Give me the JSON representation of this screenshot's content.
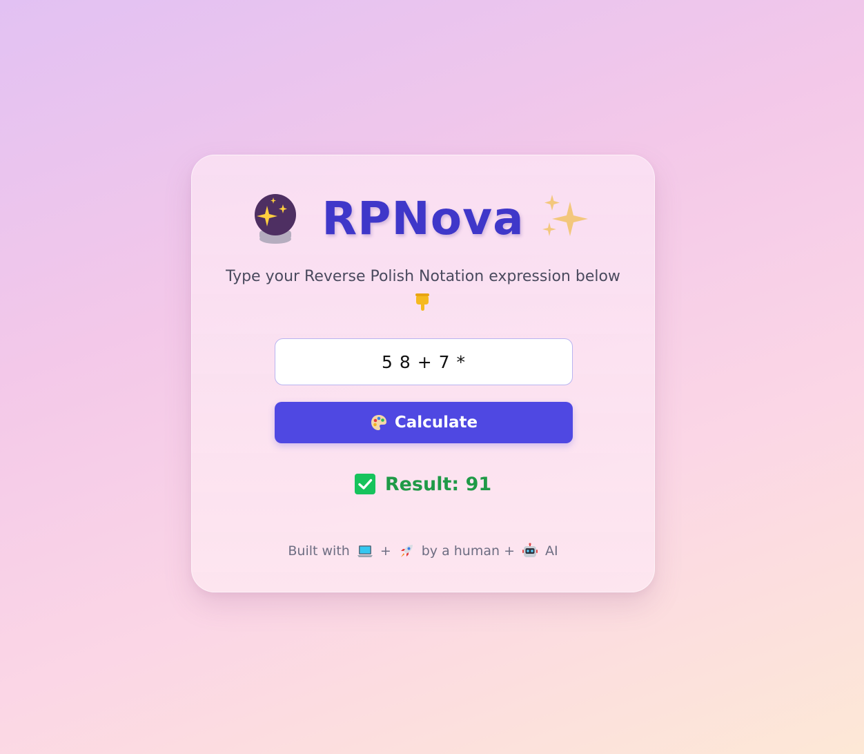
{
  "app": {
    "title": "RPNova"
  },
  "subtitle": {
    "text": "Type your Reverse Polish Notation expression below"
  },
  "input": {
    "value": "5 8 + 7 *",
    "placeholder": ""
  },
  "button": {
    "label": "Calculate"
  },
  "result": {
    "text": "Result: 91"
  },
  "footer": {
    "part1": "Built with",
    "plus1": "+",
    "part2": "by a human +",
    "part3": "AI"
  },
  "icons": {
    "title_left": "crystal-ball-icon",
    "title_right": "sparkles-icon",
    "subtitle_end": "pointing-down-icon",
    "button": "artist-palette-icon",
    "result": "check-mark-icon",
    "footer": [
      "laptop-icon",
      "rocket-icon",
      "robot-icon"
    ]
  },
  "colors": {
    "title": "#3f37c9",
    "button_bg": "#4f48e2",
    "result": "#1f9a47",
    "check_bg": "#16c35c",
    "subtitle": "#4a4a5e",
    "footer": "#6d6d82"
  }
}
